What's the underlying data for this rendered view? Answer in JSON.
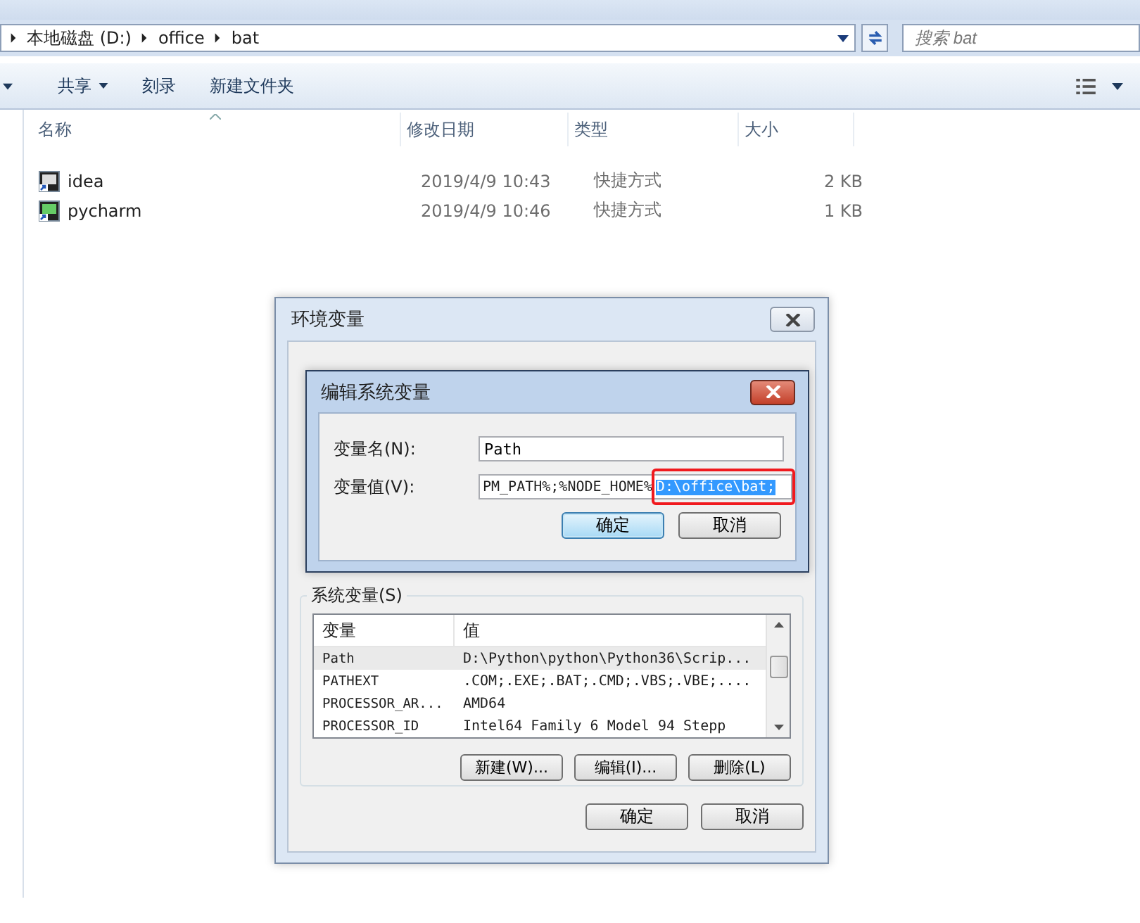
{
  "explorer": {
    "breadcrumb": [
      "本地磁盘 (D:)",
      "office",
      "bat"
    ],
    "search": {
      "placeholder": "搜索 bat"
    },
    "toolbar": [
      {
        "label": "共享",
        "menu": true
      },
      {
        "label": "刻录",
        "menu": false
      },
      {
        "label": "新建文件夹",
        "menu": false
      }
    ],
    "columns": [
      "名称",
      "修改日期",
      "类型",
      "大小"
    ],
    "files": [
      {
        "name": "idea",
        "modified": "2019/4/9 10:43",
        "type": "快捷方式",
        "size": "2 KB"
      },
      {
        "name": "pycharm",
        "modified": "2019/4/9 10:46",
        "type": "快捷方式",
        "size": "1 KB"
      }
    ]
  },
  "env_dialog": {
    "title": "环境变量",
    "system_group": "系统变量(S)",
    "columns": [
      "变量",
      "值"
    ],
    "rows": [
      {
        "name": "Path",
        "value": "D:\\Python\\python\\Python36\\Scrip...",
        "selected": true
      },
      {
        "name": "PATHEXT",
        "value": ".COM;.EXE;.BAT;.CMD;.VBS;.VBE;....",
        "selected": false
      },
      {
        "name": "PROCESSOR_AR...",
        "value": "AMD64",
        "selected": false
      },
      {
        "name": "PROCESSOR_ID",
        "value": "Intel64 Family 6 Model 94 Stepp",
        "selected": false
      }
    ],
    "list_buttons": [
      "新建(W)...",
      "编辑(I)...",
      "删除(L)"
    ],
    "buttons": [
      "确定",
      "取消"
    ]
  },
  "edit_dialog": {
    "title": "编辑系统变量",
    "name_label": "变量名(N):",
    "name_value": "Path",
    "value_label": "变量值(V):",
    "value_text": "PM_PATH%;%NODE_HOME%",
    "value_selected": "D:\\office\\bat;",
    "buttons": [
      {
        "label": "确定",
        "default": true
      },
      {
        "label": "取消",
        "default": false
      }
    ]
  }
}
